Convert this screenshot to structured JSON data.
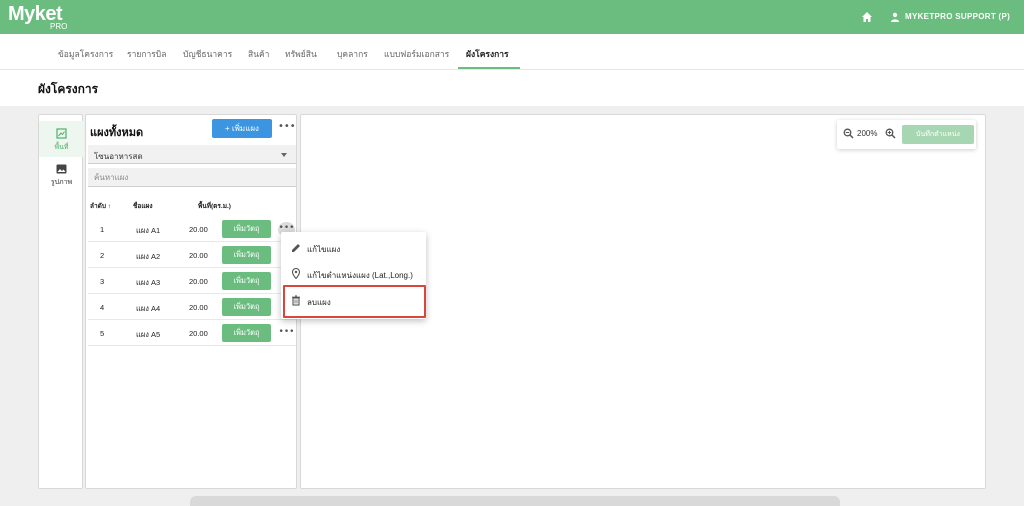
{
  "app": {
    "logo": "Myket",
    "logo_sub": "PRO",
    "user_name": "MYKETPRO SUPPORT (P)",
    "brand_color": "#6bbd7f",
    "accent_blue": "#3c95e0",
    "danger_color": "#d8473a"
  },
  "tabs": [
    {
      "label": "ข้อมูลโครงการ",
      "active": false
    },
    {
      "label": "รายการบิล",
      "active": false
    },
    {
      "label": "บัญชีธนาคาร",
      "active": false
    },
    {
      "label": "สินค้า",
      "active": false
    },
    {
      "label": "ทรัพย์สิน",
      "active": false
    },
    {
      "label": "บุคลากร",
      "active": false
    },
    {
      "label": "แบบฟอร์มเอกสาร",
      "active": false
    },
    {
      "label": "ผังโครงการ",
      "active": true
    }
  ],
  "page_title": "ผังโครงการ",
  "sidebar": {
    "items": [
      {
        "label": "พื้นที่",
        "icon": "area-map-icon",
        "active": true
      },
      {
        "label": "รูปภาพ",
        "icon": "image-icon",
        "active": false
      }
    ]
  },
  "list": {
    "title": "แผงทั้งหมด",
    "add_button": "+ เพิ่มแผง",
    "more": "•••",
    "zone_select": "โซนอาหารสด",
    "search_placeholder": "ค้นหาแผง",
    "columns": [
      "ลำดับ",
      "ชื่อแผง",
      "พื้นที่(ตร.ม.)"
    ],
    "sort_indicator": "↑",
    "rows": [
      {
        "no": "1",
        "name": "แผง A1",
        "area": "20.00",
        "action": "เพิ่มวัตถุ"
      },
      {
        "no": "2",
        "name": "แผง A2",
        "area": "20.00",
        "action": "เพิ่มวัตถุ"
      },
      {
        "no": "3",
        "name": "แผง A3",
        "area": "20.00",
        "action": "เพิ่มวัตถุ"
      },
      {
        "no": "4",
        "name": "แผง A4",
        "area": "20.00",
        "action": "เพิ่มวัตถุ"
      },
      {
        "no": "5",
        "name": "แผง A5",
        "area": "20.00",
        "action": "เพิ่มวัตถุ"
      }
    ]
  },
  "canvas": {
    "zoom": "200%",
    "save_position": "บันทึกตำแหน่ง"
  },
  "context_menu": {
    "items": [
      {
        "label": "แก้ไขแผง",
        "icon": "pencil-icon"
      },
      {
        "label": "แก้ไขตำแหน่งแผง (Lat.,Long.)",
        "icon": "location-pin-icon"
      },
      {
        "label": "ลบแผง",
        "icon": "trash-icon",
        "highlighted": true
      }
    ]
  }
}
